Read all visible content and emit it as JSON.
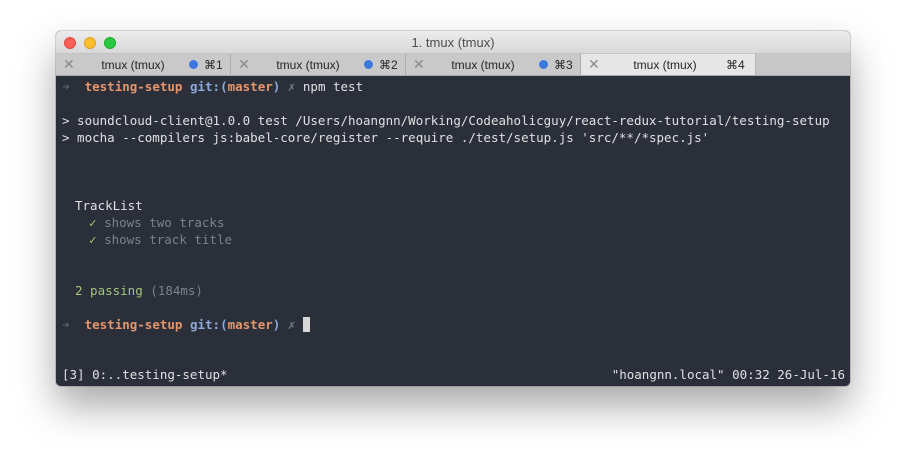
{
  "window": {
    "title": "1. tmux (tmux)"
  },
  "tabs": [
    {
      "name": "tmux (tmux)",
      "shortcut": "⌘1",
      "has_dot": true
    },
    {
      "name": "tmux (tmux)",
      "shortcut": "⌘2",
      "has_dot": true
    },
    {
      "name": "tmux (tmux)",
      "shortcut": "⌘3",
      "has_dot": true
    },
    {
      "name": "tmux (tmux)",
      "shortcut": "⌘4",
      "has_dot": false
    }
  ],
  "prompt": {
    "arrow": "➜",
    "dir": "testing-setup",
    "git": "git:(",
    "branch": "master",
    "git_close": ")",
    "dirty": "✗"
  },
  "command": "npm test",
  "output": {
    "line1": "> soundcloud-client@1.0.0 test /Users/hoangnn/Working/Codeaholicguy/react-redux-tutorial/testing-setup",
    "line2": "> mocha --compilers js:babel-core/register --require ./test/setup.js 'src/**/*spec.js'",
    "suite": "TrackList",
    "tests": [
      {
        "check": "✓",
        "title": "shows two tracks"
      },
      {
        "check": "✓",
        "title": "shows track title"
      }
    ],
    "passing": "2 passing",
    "duration": "(184ms)"
  },
  "statusbar": {
    "left": "[3] 0:..testing-setup*",
    "right": "\"hoangnn.local\" 00:32 26-Jul-16"
  }
}
